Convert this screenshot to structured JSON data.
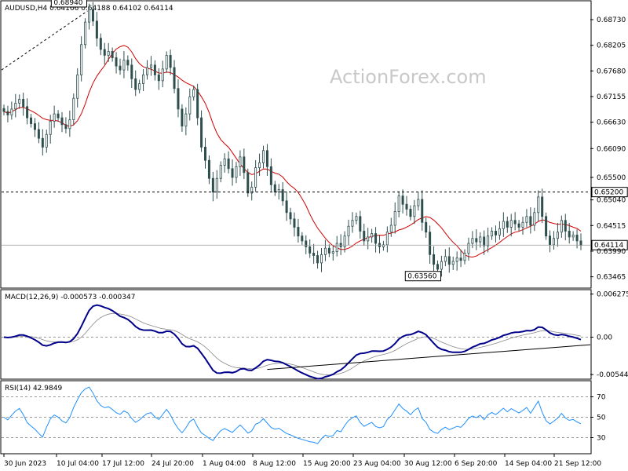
{
  "chart_data": [
    {
      "type": "candlestick",
      "symbol_header": "AUDUSD,H4  0.64166 0.64188 0.64102 0.64114",
      "watermark": "ActionForex.com",
      "x_ticks": [
        "30 Jun 2023",
        "10 Jul 04:00",
        "17 Jul 12:00",
        "24 Jul 20:00",
        "1 Aug 04:00",
        "8 Aug 12:00",
        "15 Aug 20:00",
        "23 Aug 04:00",
        "30 Aug 12:00",
        "6 Sep 20:00",
        "14 Sep 04:00",
        "21 Sep 12:00"
      ],
      "y_ticks": [
        "0.68730",
        "0.68205",
        "0.67680",
        "0.67155",
        "0.66630",
        "0.66090",
        "0.65500",
        "0.65040",
        "0.64515",
        "0.63990",
        "0.63465"
      ],
      "ylim": [
        0.6325,
        0.691
      ],
      "annotations": {
        "high": "0.68940",
        "low": "0.63560",
        "resistance": "0.65200",
        "last": "0.64114"
      },
      "close": [
        0.6685,
        0.6678,
        0.669,
        0.6702,
        0.671,
        0.6695,
        0.6672,
        0.666,
        0.6648,
        0.663,
        0.6612,
        0.6638,
        0.6665,
        0.668,
        0.6672,
        0.6658,
        0.665,
        0.6668,
        0.6712,
        0.676,
        0.6822,
        0.6868,
        0.6894,
        0.687,
        0.6835,
        0.6812,
        0.68,
        0.6808,
        0.6795,
        0.6778,
        0.677,
        0.679,
        0.678,
        0.6752,
        0.673,
        0.6742,
        0.676,
        0.6775,
        0.678,
        0.676,
        0.6748,
        0.6772,
        0.68,
        0.6775,
        0.6732,
        0.669,
        0.6655,
        0.668,
        0.6715,
        0.673,
        0.6672,
        0.6612,
        0.6585,
        0.6548,
        0.652,
        0.6548,
        0.6575,
        0.6588,
        0.6568,
        0.655,
        0.6572,
        0.6592,
        0.656,
        0.6518,
        0.653,
        0.657,
        0.658,
        0.6605,
        0.6572,
        0.6535,
        0.652,
        0.6525,
        0.6502,
        0.6478,
        0.6465,
        0.6448,
        0.643,
        0.642,
        0.6408,
        0.6395,
        0.639,
        0.6375,
        0.6392,
        0.6405,
        0.6395,
        0.6398,
        0.6415,
        0.6408,
        0.643,
        0.645,
        0.6462,
        0.647,
        0.644,
        0.642,
        0.6428,
        0.6435,
        0.6415,
        0.6408,
        0.6412,
        0.6438,
        0.6452,
        0.648,
        0.6512,
        0.6495,
        0.6485,
        0.647,
        0.6492,
        0.6505,
        0.6458,
        0.6438,
        0.6392,
        0.6372,
        0.6362,
        0.6378,
        0.6388,
        0.6372,
        0.6378,
        0.6385,
        0.638,
        0.6395,
        0.6415,
        0.6425,
        0.6418,
        0.6428,
        0.641,
        0.643,
        0.644,
        0.6432,
        0.6445,
        0.646,
        0.6448,
        0.6462,
        0.6455,
        0.6448,
        0.6458,
        0.647,
        0.6452,
        0.6478,
        0.651,
        0.647,
        0.643,
        0.6412,
        0.6425,
        0.6438,
        0.6462,
        0.644,
        0.6428,
        0.6432,
        0.642,
        0.6411
      ],
      "ma_period_label": "",
      "macd": {
        "label": "MACD(12,26,9) -0.000573 -0.000347",
        "y_ticks": [
          "0.006275",
          "0.00",
          "-0.005446"
        ],
        "ylim": [
          -0.006,
          0.0068
        ]
      },
      "rsi": {
        "label": "RSI(14) 42.9849",
        "y_ticks": [
          "70",
          "50",
          "30"
        ],
        "ylim": [
          15,
          85
        ]
      }
    }
  ]
}
